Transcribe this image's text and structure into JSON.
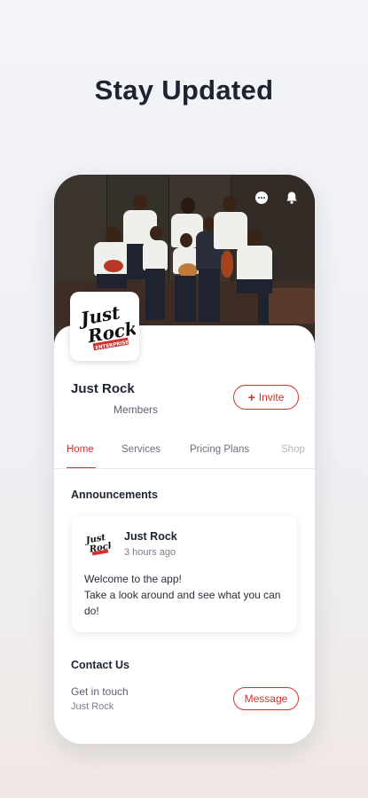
{
  "headline": "Stay Updated",
  "header": {
    "icons": [
      "chat-icon",
      "bell-icon"
    ]
  },
  "profile": {
    "logo_text_line1": "Just",
    "logo_text_line2": "Rock",
    "logo_tag": "ENTERPRISE",
    "name": "Just Rock",
    "members_label": "Members",
    "invite_label": "Invite"
  },
  "tabs": [
    {
      "label": "Home",
      "active": true
    },
    {
      "label": "Services",
      "active": false
    },
    {
      "label": "Pricing Plans",
      "active": false
    },
    {
      "label": "Shop",
      "active": false
    }
  ],
  "announcements": {
    "title": "Announcements",
    "post": {
      "author": "Just Rock",
      "time": "3 hours ago",
      "body_line1": "Welcome to the app!",
      "body_line2": "Take a look around and see what you can do!"
    }
  },
  "contact": {
    "title": "Contact Us",
    "subtitle": "Get in touch",
    "name": "Just Rock",
    "message_label": "Message"
  },
  "colors": {
    "accent": "#d6302e",
    "text_dark": "#1d2330"
  }
}
